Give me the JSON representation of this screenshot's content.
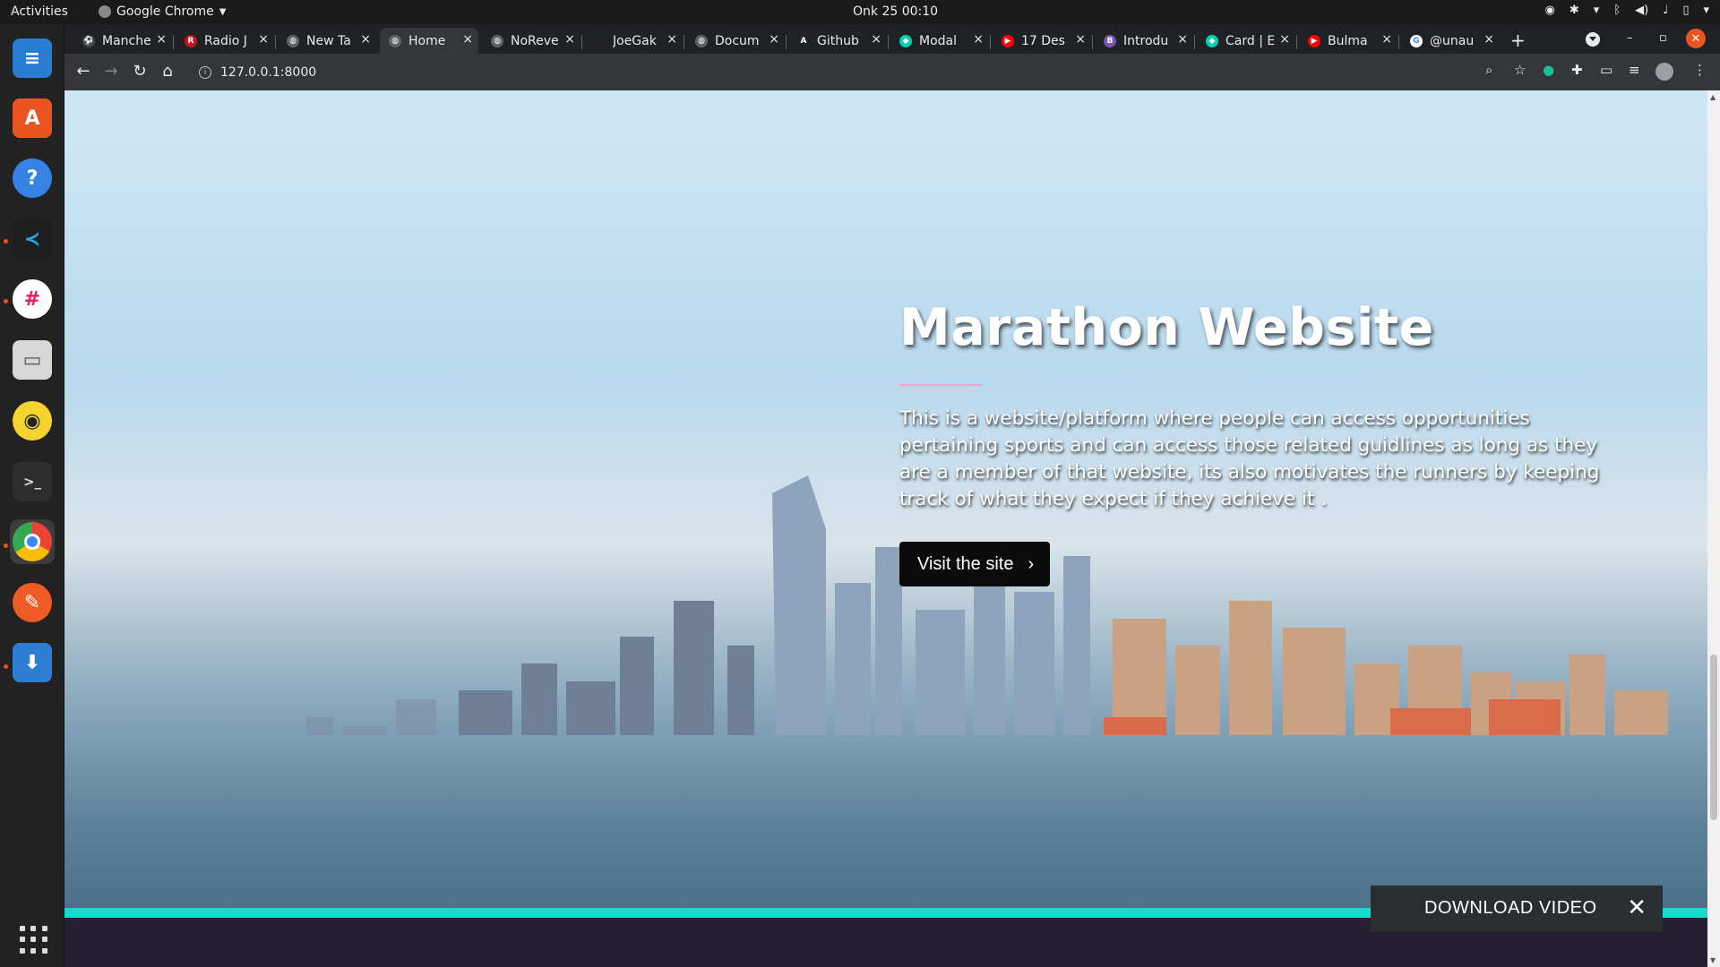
{
  "topbar": {
    "activities": "Activities",
    "app_name": "Google Chrome",
    "clock": "Onk 25  00:10"
  },
  "dock": {
    "items": [
      {
        "name": "libreoffice-writer",
        "color": "#2a7bd3"
      },
      {
        "name": "ubuntu-software",
        "color": "#e95420"
      },
      {
        "name": "help",
        "color": "#3584e4"
      },
      {
        "name": "vscode",
        "color": "#1f7ecc"
      },
      {
        "name": "slack",
        "color": "#ffffff"
      },
      {
        "name": "files",
        "color": "#cfcfcf"
      },
      {
        "name": "rhythmbox",
        "color": "#f6d32d"
      },
      {
        "name": "terminal",
        "color": "#2e2e2e"
      },
      {
        "name": "chrome",
        "color": "#4285f4"
      },
      {
        "name": "postman",
        "color": "#ef5b25"
      },
      {
        "name": "installer",
        "color": "#2d7dd2"
      }
    ]
  },
  "browser": {
    "tabs": [
      {
        "label": "Manche",
        "favicon": "ball"
      },
      {
        "label": "Radio J",
        "favicon": "radio"
      },
      {
        "label": "New Ta",
        "favicon": "globe"
      },
      {
        "label": "Home",
        "favicon": "globe",
        "active": true
      },
      {
        "label": "NoReve",
        "favicon": "globe"
      },
      {
        "label": "JoeGak",
        "favicon": "github"
      },
      {
        "label": "Docum",
        "favicon": "globe"
      },
      {
        "label": "Github",
        "favicon": "a"
      },
      {
        "label": "Modal",
        "favicon": "bulma"
      },
      {
        "label": "17 Des",
        "favicon": "youtube"
      },
      {
        "label": "Introdu",
        "favicon": "bootstrap"
      },
      {
        "label": "Card | E",
        "favicon": "bulma"
      },
      {
        "label": "Bulma",
        "favicon": "youtube"
      },
      {
        "label": "@unau",
        "favicon": "google"
      }
    ],
    "new_tab": "+",
    "url": "127.0.0.1:8000",
    "close_glyph": "×"
  },
  "page": {
    "hero_title": "Marathon Website",
    "hero_description": "This is a website/platform where people can access opportunities pertaining sports and can access those related guidlines as long as they are a member of that website, its also motivates the runners by keeping track of what they expect if they achieve it .",
    "cta_label": "Visit the site",
    "download_label": "DOWNLOAD VIDEO"
  },
  "colors": {
    "accent_teal": "#13dccf",
    "rule_pink": "#f5a3c4",
    "dark_band": "#251f33"
  }
}
